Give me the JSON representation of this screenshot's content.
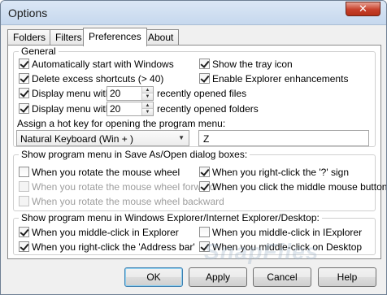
{
  "window": {
    "title": "Options",
    "close_symbol": "✕"
  },
  "tabs": [
    {
      "label": "Folders"
    },
    {
      "label": "Filters"
    },
    {
      "label": "Preferences",
      "active": true
    },
    {
      "label": "About"
    }
  ],
  "general": {
    "title": "General",
    "auto_start": {
      "label": "Automatically start with Windows",
      "checked": true
    },
    "tray_icon": {
      "label": "Show the tray icon",
      "checked": true
    },
    "delete_shortcuts": {
      "label": "Delete excess shortcuts (> 40)",
      "checked": true
    },
    "explorer_enh": {
      "label": "Enable Explorer enhancements",
      "checked": true
    },
    "files_menu": {
      "label": "Display menu with",
      "value": "20",
      "suffix": "recently opened files",
      "checked": true
    },
    "folders_menu": {
      "label": "Display menu with",
      "value": "20",
      "suffix": "recently opened folders",
      "checked": true
    },
    "hotkey_label": "Assign a hot key for opening the program menu:",
    "keyboard_select": "Natural Keyboard (Win + )",
    "hotkey_value": "Z"
  },
  "save_as": {
    "title": "Show program menu in Save As/Open dialog boxes:",
    "rotate_wheel": {
      "label": "When you rotate the mouse wheel",
      "checked": false
    },
    "right_click_sign": {
      "label": "When you right-click the '?' sign",
      "checked": true
    },
    "rotate_forward": {
      "label": "When you rotate the mouse wheel forward",
      "checked": false,
      "disabled": true
    },
    "middle_button": {
      "label": "When you click the middle mouse button",
      "checked": true
    },
    "rotate_backward": {
      "label": "When you rotate the mouse wheel backward",
      "checked": false,
      "disabled": true
    }
  },
  "explorer": {
    "title": "Show program menu in Windows Explorer/Internet Explorer/Desktop:",
    "middle_explorer": {
      "label": "When you middle-click in Explorer",
      "checked": true
    },
    "middle_iexplorer": {
      "label": "When you middle-click in IExplorer",
      "checked": false
    },
    "right_address": {
      "label": "When you right-click the 'Address bar'",
      "checked": true
    },
    "middle_desktop": {
      "label": "When you middle-click on Desktop",
      "checked": true
    }
  },
  "buttons": {
    "ok": "OK",
    "apply": "Apply",
    "cancel": "Cancel",
    "help": "Help"
  },
  "watermark": "SnapFiles"
}
